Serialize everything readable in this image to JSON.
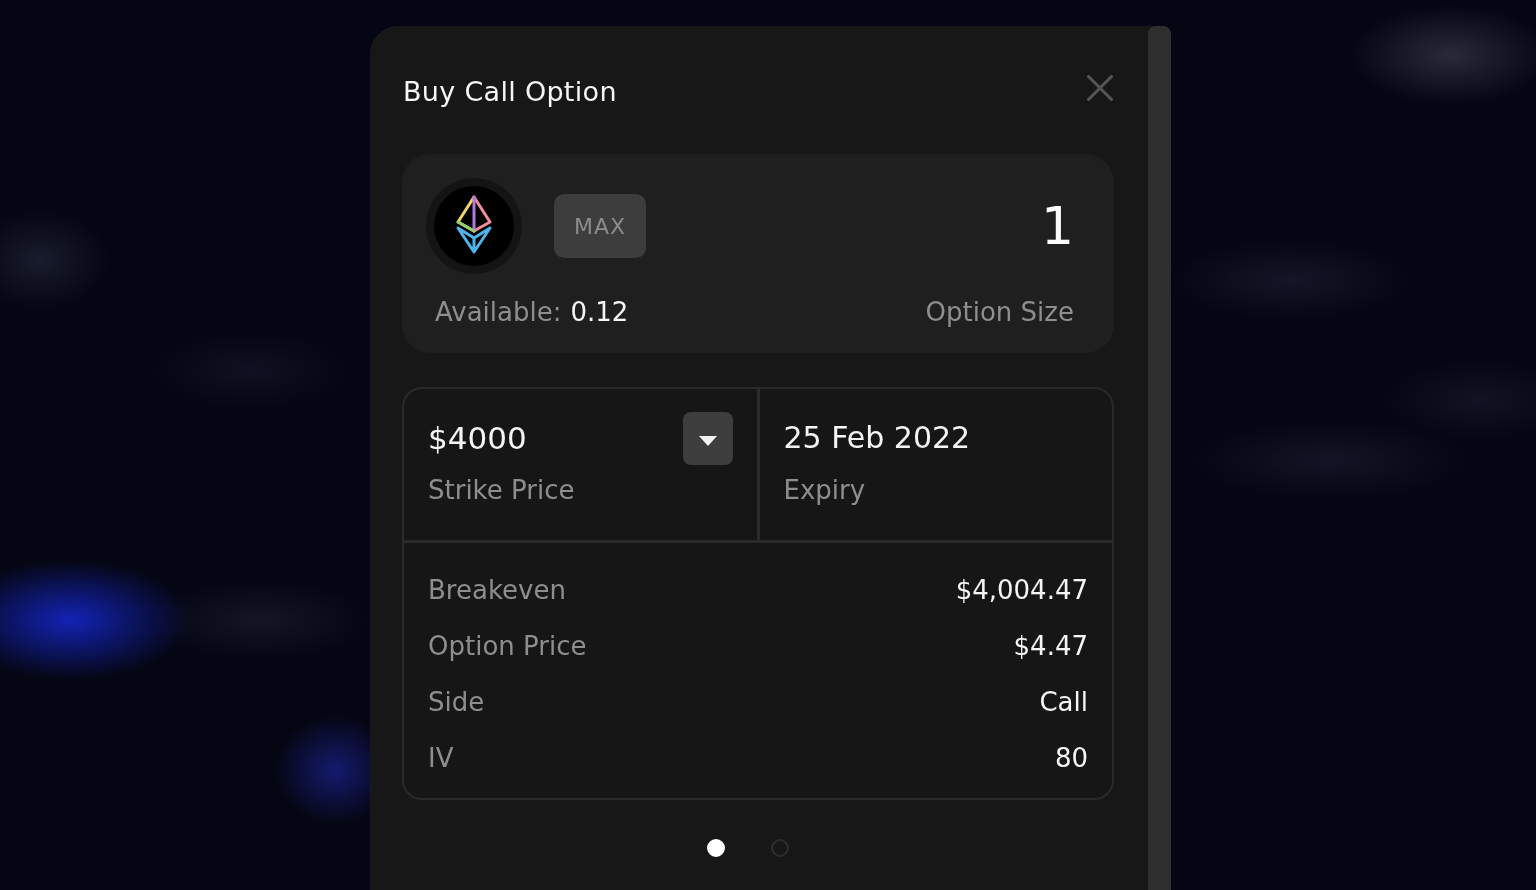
{
  "dialog": {
    "title": "Buy Call Option"
  },
  "amount_card": {
    "max_button": "MAX",
    "option_size": "1",
    "available_label": "Available:",
    "available_value": "0.12",
    "size_label": "Option Size"
  },
  "strike": {
    "value": "$4000",
    "label": "Strike Price"
  },
  "expiry": {
    "value": "25 Feb 2022",
    "label": "Expiry"
  },
  "details": [
    {
      "label": "Breakeven",
      "value": "$4,004.47"
    },
    {
      "label": "Option Price",
      "value": "$4.47"
    },
    {
      "label": "Side",
      "value": "Call"
    },
    {
      "label": "IV",
      "value": "80"
    }
  ],
  "pages": [
    {
      "selected": true
    },
    {
      "selected": false
    }
  ]
}
